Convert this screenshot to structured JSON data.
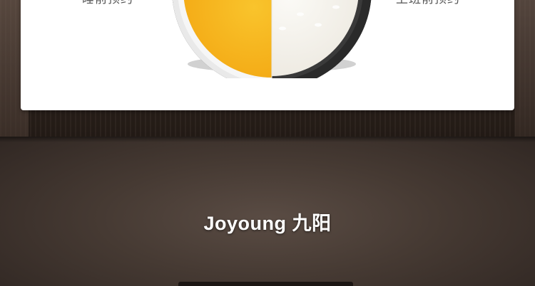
{
  "card": {
    "left_label": "睡前预约",
    "right_label": "上班前预约"
  },
  "bowl": {
    "left_content": "yellow porridge",
    "right_content": "white rice",
    "colors": {
      "porridge": "#f6b21a",
      "rice": "#f4f1ea",
      "bowl_rim": "#2c2c2c"
    }
  },
  "brand": {
    "text": "Joyoung 九阳"
  },
  "colors": {
    "card_bg": "#ffffff",
    "lower_bg": "#463a33",
    "brand_text": "#ffffff"
  }
}
